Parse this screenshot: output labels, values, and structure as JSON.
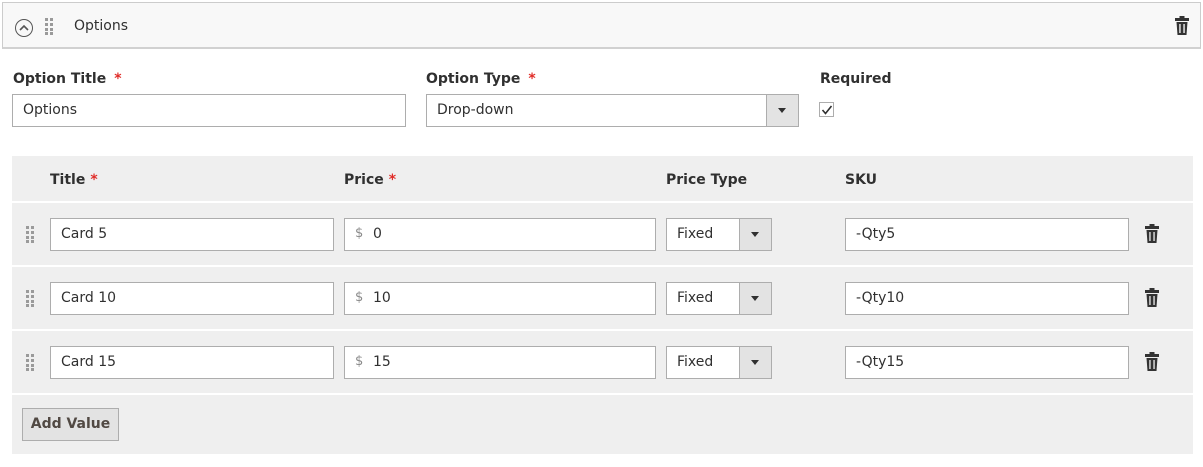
{
  "header": {
    "title": "Options"
  },
  "form": {
    "option_title_label": "Option Title",
    "required_star": "*",
    "option_title_value": "Options",
    "option_type_label": "Option Type",
    "option_type_value": "Drop-down",
    "required_label": "Required",
    "required_checked": true
  },
  "grid": {
    "columns": {
      "title": "Title",
      "price": "Price",
      "price_type": "Price Type",
      "sku": "SKU"
    },
    "currency_symbol": "$",
    "rows": [
      {
        "title": "Card 5",
        "price": "0",
        "price_type": "Fixed",
        "sku": "-Qty5"
      },
      {
        "title": "Card 10",
        "price": "10",
        "price_type": "Fixed",
        "sku": "-Qty10"
      },
      {
        "title": "Card 15",
        "price": "15",
        "price_type": "Fixed",
        "sku": "-Qty15"
      }
    ],
    "add_value_label": "Add Value"
  },
  "icons": {
    "collapse": "chevron-up-circle-icon",
    "drag": "drag-handle-icon",
    "delete": "trash-icon"
  },
  "colors": {
    "required": "#e02b27",
    "border": "#adadad",
    "grid_bg": "#efefef"
  }
}
